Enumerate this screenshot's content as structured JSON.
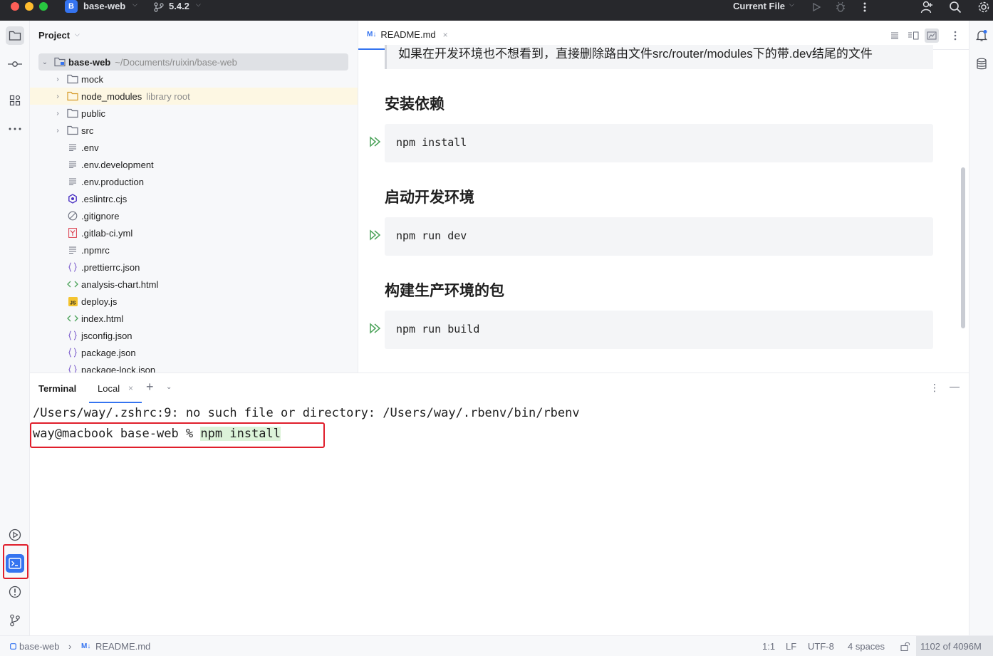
{
  "titlebar": {
    "project_badge": "B",
    "project_name": "base-web",
    "branch": "5.4.2",
    "run_config": "Current File"
  },
  "project_panel": {
    "title": "Project",
    "root": {
      "name": "base-web",
      "path": "~/Documents/ruixin/base-web"
    },
    "items": [
      {
        "name": "mock",
        "kind": "folder",
        "hint": ""
      },
      {
        "name": "node_modules",
        "kind": "folder-lib",
        "hint": "library root"
      },
      {
        "name": "public",
        "kind": "folder",
        "hint": ""
      },
      {
        "name": "src",
        "kind": "folder",
        "hint": ""
      },
      {
        "name": ".env",
        "kind": "text",
        "hint": ""
      },
      {
        "name": ".env.development",
        "kind": "text",
        "hint": ""
      },
      {
        "name": ".env.production",
        "kind": "text",
        "hint": ""
      },
      {
        "name": ".eslintrc.cjs",
        "kind": "eslint",
        "hint": ""
      },
      {
        "name": ".gitignore",
        "kind": "ignore",
        "hint": ""
      },
      {
        "name": ".gitlab-ci.yml",
        "kind": "yaml",
        "hint": ""
      },
      {
        "name": ".npmrc",
        "kind": "text",
        "hint": ""
      },
      {
        "name": ".prettierrc.json",
        "kind": "json",
        "hint": ""
      },
      {
        "name": "analysis-chart.html",
        "kind": "html",
        "hint": ""
      },
      {
        "name": "deploy.js",
        "kind": "js",
        "hint": ""
      },
      {
        "name": "index.html",
        "kind": "html",
        "hint": ""
      },
      {
        "name": "jsconfig.json",
        "kind": "json",
        "hint": ""
      },
      {
        "name": "package.json",
        "kind": "json",
        "hint": ""
      },
      {
        "name": "package-lock.json",
        "kind": "json",
        "hint": ""
      }
    ]
  },
  "editor": {
    "tab": {
      "badge": "M↓",
      "label": "README.md"
    },
    "quote_text": "如果在开发环境也不想看到，直接删除路由文件src/router/modules下的带.dev结尾的文件",
    "sections": [
      {
        "heading": "安装依赖",
        "code": "npm install"
      },
      {
        "heading": "启动开发环境",
        "code": "npm run dev"
      },
      {
        "heading": "构建生产环境的包",
        "code": "npm run build"
      }
    ]
  },
  "terminal": {
    "title": "Terminal",
    "tab_label": "Local",
    "line1": "/Users/way/.zshrc:9: no such file or directory: /Users/way/.rbenv/bin/rbenv",
    "prompt": "way@macbook base-web % ",
    "command": "npm install"
  },
  "statusbar": {
    "breadcrumb_project": "base-web",
    "breadcrumb_badge": "M↓",
    "breadcrumb_file": "README.md",
    "position": "1:1",
    "line_ending": "LF",
    "encoding": "UTF-8",
    "indent": "4 spaces",
    "memory": "1102 of 4096M"
  },
  "colors": {
    "accent": "#3574f0",
    "highlight_box": "#e01e2b",
    "run_green": "#4ca35a"
  }
}
